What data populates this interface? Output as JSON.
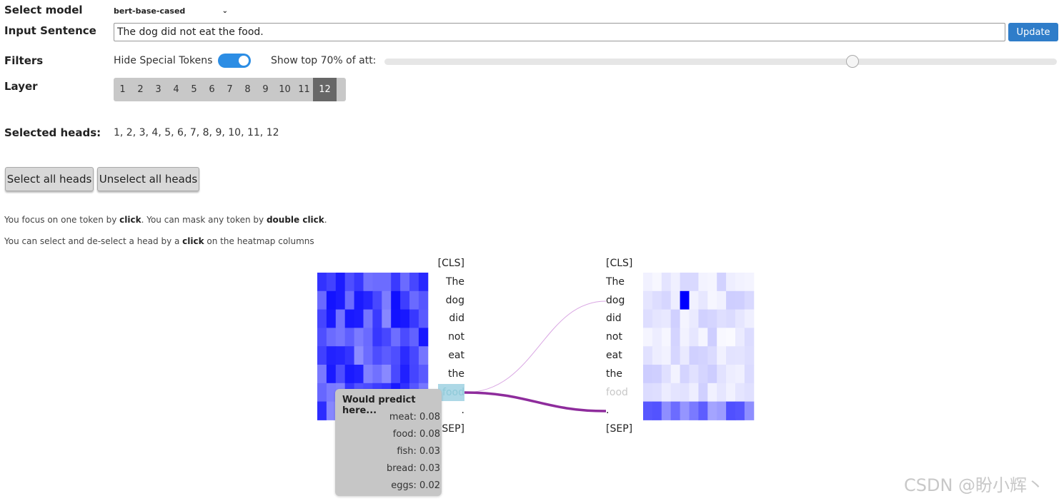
{
  "controls": {
    "select_model_label": "Select model",
    "model_value": "bert-base-cased",
    "input_sentence_label": "Input Sentence",
    "sentence_value": "The dog did not eat the food.",
    "update_label": "Update",
    "filters_label": "Filters",
    "hide_special_label": "Hide Special Tokens",
    "hide_special_on": true,
    "show_top_label": "Show top 70% of att:",
    "show_top_value_percent": 70,
    "layer_label": "Layer",
    "layers": [
      "1",
      "2",
      "3",
      "4",
      "5",
      "6",
      "7",
      "8",
      "9",
      "10",
      "11",
      "12"
    ],
    "active_layer": "12",
    "selected_heads_label": "Selected heads:",
    "selected_heads_value": "1, 2, 3, 4, 5, 6, 7, 8, 9, 10, 11, 12",
    "select_all_label": "Select all heads",
    "unselect_all_label": "Unselect all heads"
  },
  "instructions": {
    "line1_pre": "You focus on one token by ",
    "line1_b1": "click",
    "line1_mid": ". You can mask any token by ",
    "line1_b2": "double click",
    "line1_end": ".",
    "line2_pre": "You can select and de-select a head by a ",
    "line2_b": "click",
    "line2_end": " on the heatmap columns"
  },
  "tokens": [
    "[CLS]",
    "The",
    "dog",
    "did",
    "not",
    "eat",
    "the",
    "food",
    ".",
    "[SEP]"
  ],
  "focused_token": "food",
  "tooltip": {
    "title": "Would predict here...",
    "predictions": [
      "meat: 0.08",
      "food: 0.08",
      "fish: 0.03",
      "bread: 0.03",
      "eggs: 0.02"
    ]
  },
  "colors": {
    "accent": "#2f7dc9",
    "toggle": "#2c8de4",
    "link_strong": "#8e2c9c",
    "link_weak": "#d49ee0",
    "focus_bg": "#add8e6"
  },
  "watermark": "CSDN @盼小辉丶"
}
